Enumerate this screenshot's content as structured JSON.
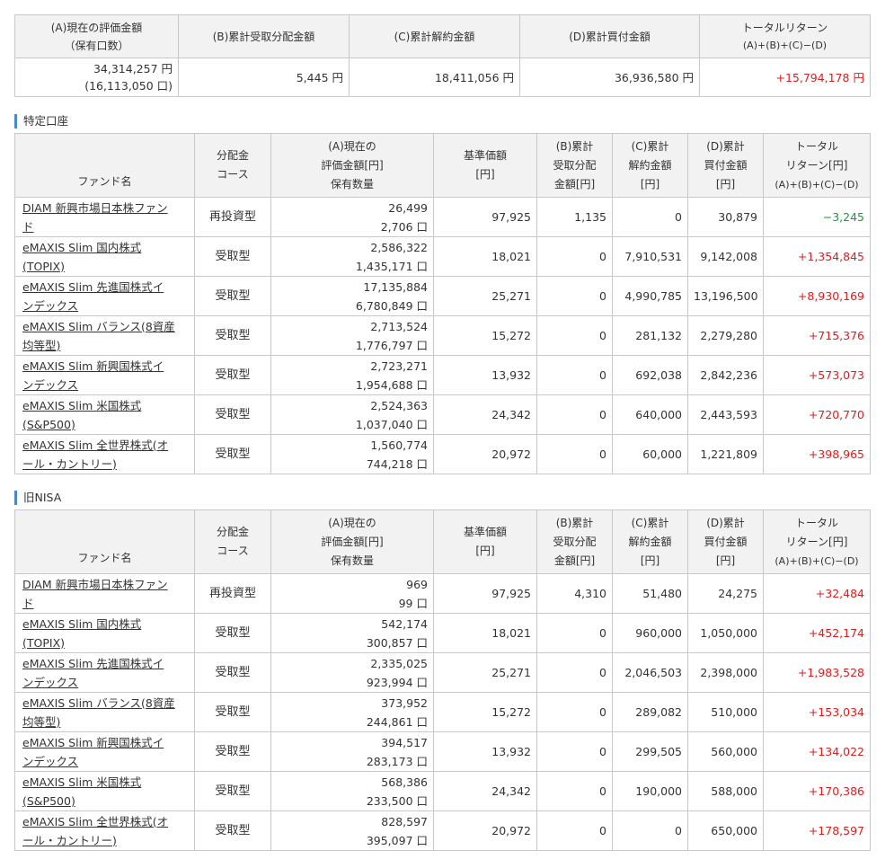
{
  "summary": {
    "headers": [
      {
        "l1": "(A)現在の評価金額",
        "l2": "（保有口数）"
      },
      {
        "l1": "(B)累計受取分配金額",
        "l2": ""
      },
      {
        "l1": "(C)累計解約金額",
        "l2": ""
      },
      {
        "l1": "(D)累計買付金額",
        "l2": ""
      },
      {
        "l1": "トータルリターン",
        "l2": "(A)+(B)+(C)−(D)"
      }
    ],
    "values": {
      "a_amount": "34,314,257 円",
      "a_units": "(16,113,050 口)",
      "b": "5,445 円",
      "c": "18,411,056 円",
      "d": "36,936,580 円",
      "total": "+15,794,178 円"
    }
  },
  "sections": [
    {
      "title": "特定口座",
      "headers": {
        "fund": "ファンド名",
        "course_1": "分配金",
        "course_2": "コース",
        "a_1": "(A)現在の",
        "a_2": "評価金額[円]",
        "a_3": "保有数量",
        "nav_1": "基準価額",
        "nav_2": "[円]",
        "b_1": "(B)累計",
        "b_2": "受取分配",
        "b_3": "金額[円]",
        "c_1": "(C)累計",
        "c_2": "解約金額",
        "c_3": "[円]",
        "d_1": "(D)累計",
        "d_2": "買付金額",
        "d_3": "[円]",
        "t_1": "トータル",
        "t_2": "リターン[円]",
        "t_3": "(A)+(B)+(C)−(D)"
      },
      "rows": [
        {
          "fund_1": "DIAM 新興市場日本株ファン",
          "fund_2": "ド",
          "course": "再投資型",
          "amount": "26,499",
          "units": "2,706 口",
          "nav": "97,925",
          "b": "1,135",
          "c": "0",
          "d": "30,879",
          "total": "−3,245",
          "sign": "neg"
        },
        {
          "fund_1": "eMAXIS Slim 国内株式",
          "fund_2": "(TOPIX)",
          "course": "受取型",
          "amount": "2,586,322",
          "units": "1,435,171 口",
          "nav": "18,021",
          "b": "0",
          "c": "7,910,531",
          "d": "9,142,008",
          "total": "+1,354,845",
          "sign": "pos"
        },
        {
          "fund_1": "eMAXIS Slim 先進国株式イ",
          "fund_2": "ンデックス",
          "course": "受取型",
          "amount": "17,135,884",
          "units": "6,780,849 口",
          "nav": "25,271",
          "b": "0",
          "c": "4,990,785",
          "d": "13,196,500",
          "total": "+8,930,169",
          "sign": "pos"
        },
        {
          "fund_1": "eMAXIS Slim バランス(8資産",
          "fund_2": "均等型)",
          "course": "受取型",
          "amount": "2,713,524",
          "units": "1,776,797 口",
          "nav": "15,272",
          "b": "0",
          "c": "281,132",
          "d": "2,279,280",
          "total": "+715,376",
          "sign": "pos"
        },
        {
          "fund_1": "eMAXIS Slim 新興国株式イ",
          "fund_2": "ンデックス",
          "course": "受取型",
          "amount": "2,723,271",
          "units": "1,954,688 口",
          "nav": "13,932",
          "b": "0",
          "c": "692,038",
          "d": "2,842,236",
          "total": "+573,073",
          "sign": "pos"
        },
        {
          "fund_1": "eMAXIS Slim 米国株式",
          "fund_2": "(S&P500)",
          "course": "受取型",
          "amount": "2,524,363",
          "units": "1,037,040 口",
          "nav": "24,342",
          "b": "0",
          "c": "640,000",
          "d": "2,443,593",
          "total": "+720,770",
          "sign": "pos"
        },
        {
          "fund_1": "eMAXIS Slim 全世界株式(オ",
          "fund_2": "ール・カントリー)",
          "course": "受取型",
          "amount": "1,560,774",
          "units": "744,218 口",
          "nav": "20,972",
          "b": "0",
          "c": "60,000",
          "d": "1,221,809",
          "total": "+398,965",
          "sign": "pos"
        }
      ]
    },
    {
      "title": "旧NISA",
      "headers": {
        "fund": "ファンド名",
        "course_1": "分配金",
        "course_2": "コース",
        "a_1": "(A)現在の",
        "a_2": "評価金額[円]",
        "a_3": "保有数量",
        "nav_1": "基準価額",
        "nav_2": "[円]",
        "b_1": "(B)累計",
        "b_2": "受取分配",
        "b_3": "金額[円]",
        "c_1": "(C)累計",
        "c_2": "解約金額",
        "c_3": "[円]",
        "d_1": "(D)累計",
        "d_2": "買付金額",
        "d_3": "[円]",
        "t_1": "トータル",
        "t_2": "リターン[円]",
        "t_3": "(A)+(B)+(C)−(D)"
      },
      "rows": [
        {
          "fund_1": "DIAM 新興市場日本株ファン",
          "fund_2": "ド",
          "course": "再投資型",
          "amount": "969",
          "units": "99 口",
          "nav": "97,925",
          "b": "4,310",
          "c": "51,480",
          "d": "24,275",
          "total": "+32,484",
          "sign": "pos"
        },
        {
          "fund_1": "eMAXIS Slim 国内株式",
          "fund_2": "(TOPIX)",
          "course": "受取型",
          "amount": "542,174",
          "units": "300,857 口",
          "nav": "18,021",
          "b": "0",
          "c": "960,000",
          "d": "1,050,000",
          "total": "+452,174",
          "sign": "pos"
        },
        {
          "fund_1": "eMAXIS Slim 先進国株式イ",
          "fund_2": "ンデックス",
          "course": "受取型",
          "amount": "2,335,025",
          "units": "923,994 口",
          "nav": "25,271",
          "b": "0",
          "c": "2,046,503",
          "d": "2,398,000",
          "total": "+1,983,528",
          "sign": "pos"
        },
        {
          "fund_1": "eMAXIS Slim バランス(8資産",
          "fund_2": "均等型)",
          "course": "受取型",
          "amount": "373,952",
          "units": "244,861 口",
          "nav": "15,272",
          "b": "0",
          "c": "289,082",
          "d": "510,000",
          "total": "+153,034",
          "sign": "pos"
        },
        {
          "fund_1": "eMAXIS Slim 新興国株式イ",
          "fund_2": "ンデックス",
          "course": "受取型",
          "amount": "394,517",
          "units": "283,173 口",
          "nav": "13,932",
          "b": "0",
          "c": "299,505",
          "d": "560,000",
          "total": "+134,022",
          "sign": "pos"
        },
        {
          "fund_1": "eMAXIS Slim 米国株式",
          "fund_2": "(S&P500)",
          "course": "受取型",
          "amount": "568,386",
          "units": "233,500 口",
          "nav": "24,342",
          "b": "0",
          "c": "190,000",
          "d": "588,000",
          "total": "+170,386",
          "sign": "pos"
        },
        {
          "fund_1": "eMAXIS Slim 全世界株式(オ",
          "fund_2": "ール・カントリー)",
          "course": "受取型",
          "amount": "828,597",
          "units": "395,097 口",
          "nav": "20,972",
          "b": "0",
          "c": "0",
          "d": "650,000",
          "total": "+178,597",
          "sign": "pos"
        }
      ]
    }
  ],
  "colors": {
    "positive": "#e21b1b",
    "negative": "#1b9a3a",
    "header_bg": "#f2f2f2",
    "section_accent": "#4a89c8"
  }
}
